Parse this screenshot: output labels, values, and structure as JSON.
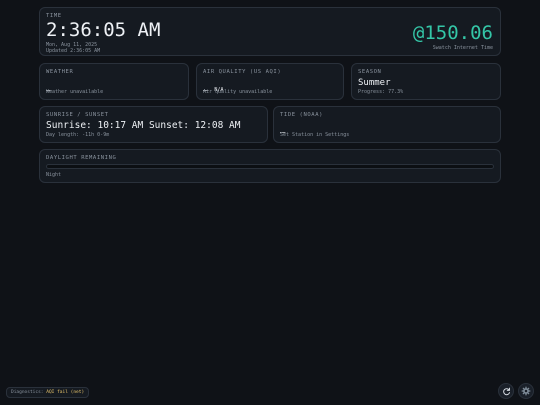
{
  "time": {
    "label": "TIME",
    "value": "2:36:05 AM",
    "date": "Mon, Aug 11, 2025",
    "updated": "Updated 2:36:05 AM",
    "beat": "@150.06",
    "beat_caption": "Swatch Internet Time"
  },
  "weather": {
    "label": "WEATHER",
    "value": "—",
    "status": "Weather unavailable"
  },
  "air_quality": {
    "label": "AIR QUALITY (US AQI)",
    "value": "—",
    "category": "N/A",
    "status": "Air quality unavailable"
  },
  "season": {
    "label": "SEASON",
    "value": "Summer",
    "progress_text": "Progress: 77.3%"
  },
  "sun": {
    "label": "SUNRISE / SUNSET",
    "value": "Sunrise: 10:17 AM Sunset: 12:08 AM",
    "day_length": "Day length: -11h 0-9m"
  },
  "tide": {
    "label": "TIDE (NOAA)",
    "value": "—",
    "status": "Set Station in Settings"
  },
  "daylight": {
    "label": "DAYLIGHT REMAINING",
    "progress": 0,
    "status": "Night"
  },
  "diagnostics": {
    "label": "Diagnostics:",
    "value": "AQI fail (net)"
  },
  "icons": {
    "refresh": "refresh-icon",
    "settings": "gear-icon"
  },
  "colors": {
    "background": "#0f1217",
    "card": "#151a21",
    "accent": "#34c6a7",
    "warning": "#e6c36a"
  }
}
